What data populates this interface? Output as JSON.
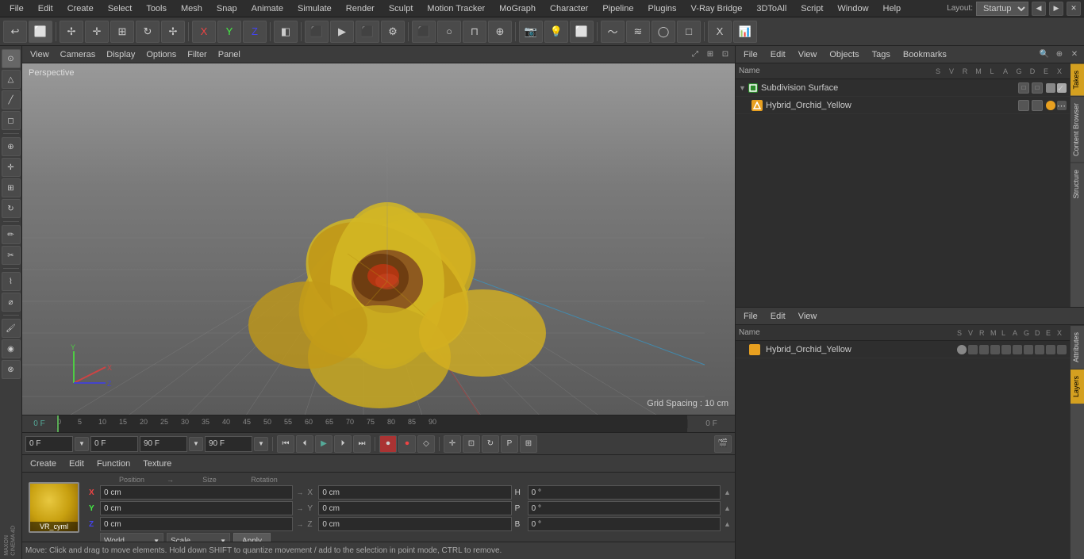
{
  "app": {
    "title": "Cinema 4D",
    "layout": "Startup"
  },
  "menu": {
    "items": [
      "File",
      "Edit",
      "Create",
      "Select",
      "Tools",
      "Mesh",
      "Snap",
      "Animate",
      "Simulate",
      "Render",
      "Sculpt",
      "Motion Tracker",
      "MoGraph",
      "Character",
      "Pipeline",
      "Plugins",
      "V-Ray Bridge",
      "3DToAll",
      "Script",
      "Window",
      "Help"
    ]
  },
  "viewport": {
    "label": "Perspective",
    "grid_spacing": "Grid Spacing : 10 cm",
    "view_menu": [
      "View",
      "Cameras",
      "Display",
      "Options",
      "Filter",
      "Panel"
    ]
  },
  "objects_panel": {
    "title": "Objects",
    "toolbar": [
      "File",
      "Edit",
      "View",
      "Objects",
      "Tags",
      "Bookmarks"
    ],
    "columns": [
      "Name",
      "S",
      "V",
      "R",
      "M",
      "L",
      "A",
      "G",
      "D",
      "E",
      "X"
    ],
    "items": [
      {
        "name": "Subdivision Surface",
        "type": "green",
        "indent": 0,
        "checked": true
      },
      {
        "name": "Hybrid_Orchid_Yellow",
        "type": "orange",
        "indent": 1,
        "checked": false
      }
    ]
  },
  "attributes_panel": {
    "toolbar": [
      "File",
      "Edit",
      "View"
    ],
    "columns": [
      "Name",
      "S",
      "V",
      "R",
      "M",
      "L",
      "A",
      "G",
      "D",
      "E",
      "X"
    ],
    "items": [
      {
        "name": "Hybrid_Orchid_Yellow"
      }
    ]
  },
  "timeline": {
    "start": "0 F",
    "end": "0 F",
    "max": "90 F",
    "labels": [
      "0",
      "5",
      "10",
      "15",
      "20",
      "25",
      "30",
      "35",
      "40",
      "45",
      "50",
      "55",
      "60",
      "65",
      "70",
      "75",
      "80",
      "85",
      "90"
    ],
    "playback_start": "0 F",
    "playback_end": "90 F",
    "playback_current": "0 F",
    "playback_max": "90 F"
  },
  "coordinates": {
    "x_label": "X",
    "y_label": "Y",
    "z_label": "Z",
    "x_val1": "0 cm",
    "x_val2": "0 cm",
    "h_label": "H",
    "h_val": "0 °",
    "y_val1": "0 cm",
    "y_val2": "0 cm",
    "p_label": "P",
    "p_val": "0 °",
    "z_val1": "0 cm",
    "z_val2": "0 cm",
    "b_label": "B",
    "b_val": "0 °",
    "world_label": "World",
    "scale_label": "Scale",
    "apply_label": "Apply"
  },
  "status": {
    "text": "Move: Click and drag to move elements. Hold down SHIFT to quantize movement / add to the selection in point mode, CTRL to remove."
  },
  "material": {
    "name": "VR_cyml",
    "menu": [
      "Create",
      "Edit",
      "Function",
      "Texture"
    ]
  },
  "vtabs": {
    "right": [
      "Takes",
      "Content Browser",
      "Structure",
      "Attributes",
      "Layers"
    ]
  }
}
